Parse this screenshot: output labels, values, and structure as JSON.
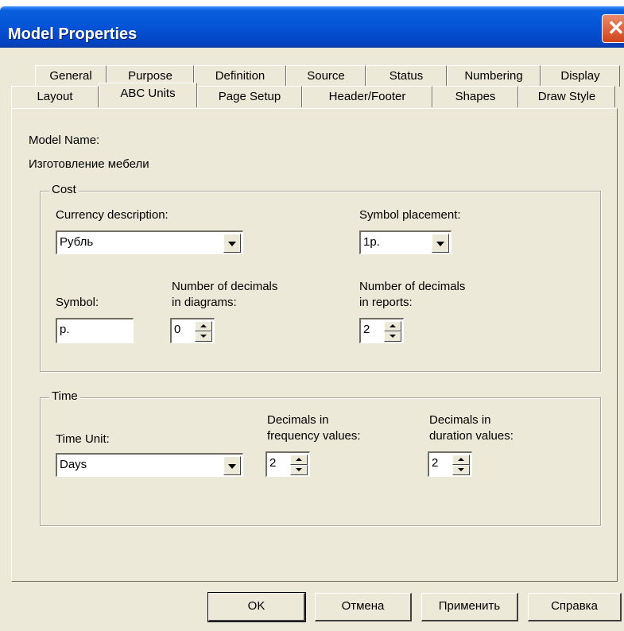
{
  "window": {
    "title": "Model Properties",
    "close_glyph": "✕"
  },
  "tabs": {
    "row1": [
      "General",
      "Purpose",
      "Definition",
      "Source",
      "Status",
      "Numbering",
      "Display"
    ],
    "row2": [
      "Layout",
      "ABC Units",
      "Page Setup",
      "Header/Footer",
      "Shapes",
      "Draw Style"
    ],
    "active": "ABC Units"
  },
  "model": {
    "name_label": "Model Name:",
    "name_value": "Изготовление мебели"
  },
  "cost": {
    "group_label": "Cost",
    "currency_label": "Currency description:",
    "currency_value": "Рубль",
    "placement_label": "Symbol placement:",
    "placement_value": "1р.",
    "symbol_label": "Symbol:",
    "symbol_value": "р.",
    "dec_diag_label_1": "Number of decimals",
    "dec_diag_label_2": "in diagrams:",
    "dec_diag_value": "0",
    "dec_rep_label_1": "Number of decimals",
    "dec_rep_label_2": "in reports:",
    "dec_rep_value": "2"
  },
  "time": {
    "group_label": "Time",
    "unit_label": "Time Unit:",
    "unit_value": "Days",
    "freq_label_1": "Decimals in",
    "freq_label_2": "frequency values:",
    "freq_value": "2",
    "dur_label_1": "Decimals in",
    "dur_label_2": "duration values:",
    "dur_value": "2"
  },
  "buttons": {
    "ok": "OK",
    "cancel": "Отмена",
    "apply": "Применить",
    "help": "Справка"
  },
  "colors": {
    "dialog_bg": "#ece9d8",
    "titlebar": "#0553d6",
    "close": "#d0451b"
  }
}
